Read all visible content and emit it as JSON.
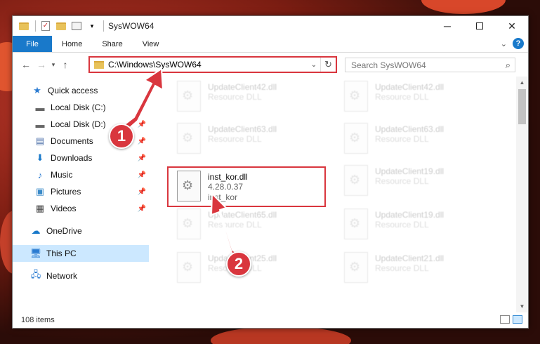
{
  "window": {
    "title": "SysWOW64",
    "controls": {
      "minimize": "─",
      "close": "✕"
    }
  },
  "ribbon": {
    "tabs": [
      "File",
      "Home",
      "Share",
      "View"
    ],
    "help": "?"
  },
  "address": {
    "path": "C:\\Windows\\SysWOW64",
    "search_placeholder": "Search SysWOW64"
  },
  "nav": {
    "quick_access": "Quick access",
    "items": [
      {
        "label": "Local Disk (C:)",
        "icon": "drive-icon",
        "pinned": true
      },
      {
        "label": "Local Disk (D:)",
        "icon": "drive-icon",
        "pinned": true
      },
      {
        "label": "Documents",
        "icon": "documents-icon",
        "pinned": true
      },
      {
        "label": "Downloads",
        "icon": "downloads-icon",
        "pinned": true
      },
      {
        "label": "Music",
        "icon": "music-icon",
        "pinned": true
      },
      {
        "label": "Pictures",
        "icon": "pictures-icon",
        "pinned": true
      },
      {
        "label": "Videos",
        "icon": "videos-icon",
        "pinned": true
      }
    ],
    "onedrive": "OneDrive",
    "this_pc": "This PC",
    "network": "Network"
  },
  "files": [
    {
      "name": "UpdateClient42.dll",
      "line2": "Resource DLL",
      "faded": true
    },
    {
      "name": "UpdateClient42.dll",
      "line2": "Resource DLL",
      "faded": true
    },
    {
      "name": "UpdateClient63.dll",
      "line2": "Resource DLL",
      "faded": true
    },
    {
      "name": "UpdateClient63.dll",
      "line2": "Resource DLL",
      "faded": true
    },
    {
      "name": "inst_kor.dll",
      "line2": "4.28.0.37",
      "line3": "inst_kor",
      "faded": false
    },
    {
      "name": "UpdateClient19.dll",
      "line2": "Resource DLL",
      "faded": true
    },
    {
      "name": "UpdateClient65.dll",
      "line2": "Resource DLL",
      "faded": true
    },
    {
      "name": "UpdateClient19.dll",
      "line2": "Resource DLL",
      "faded": true
    },
    {
      "name": "UpdateClient25.dll",
      "line2": "Resource DLL",
      "faded": true
    },
    {
      "name": "UpdateClient21.dll",
      "line2": "Resource DLL",
      "faded": true
    }
  ],
  "status": {
    "item_count": "108 items"
  },
  "annotations": {
    "step1": "1",
    "step2": "2",
    "color": "#d9363e"
  }
}
